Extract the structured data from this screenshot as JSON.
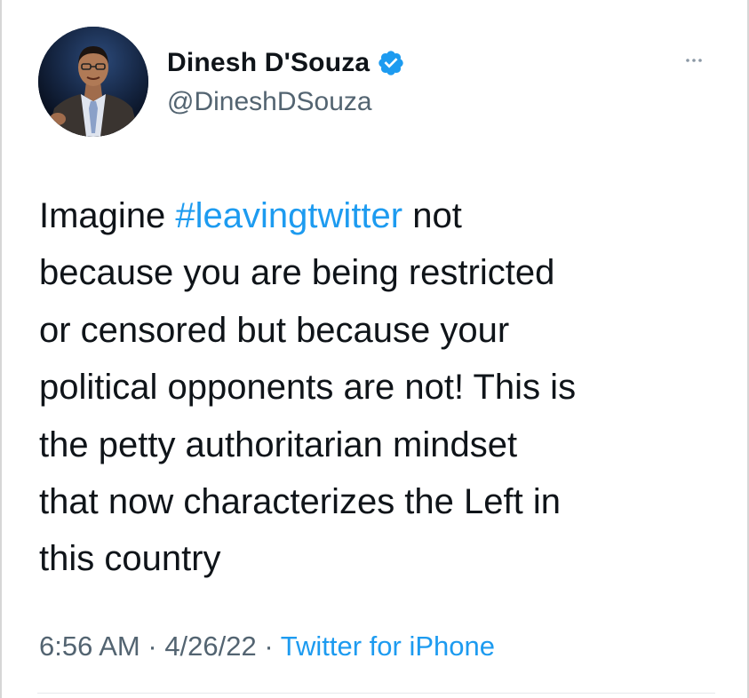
{
  "author": {
    "display_name": "Dinesh D'Souza",
    "handle": "@DineshDSouza",
    "verified": true,
    "avatar_icon": "profile-photo"
  },
  "tweet": {
    "text_before": "Imagine ",
    "hashtag": "#leavingtwitter",
    "text_after": " not\nbecause you are being restricted\nor censored but because your\npolitical opponents are not! This is\nthe petty authoritarian mindset\nthat now characterizes the Left in\nthis country",
    "time": "6:56 AM",
    "separator": " · ",
    "date": "4/26/22",
    "source": "Twitter for iPhone"
  },
  "icons": {
    "more": "more-options-icon",
    "verified": "verified-badge-icon"
  },
  "colors": {
    "link": "#1d9bf0",
    "secondary_text": "#536471",
    "primary_text": "#0f1419",
    "verified_badge": "#1d9bf0"
  }
}
